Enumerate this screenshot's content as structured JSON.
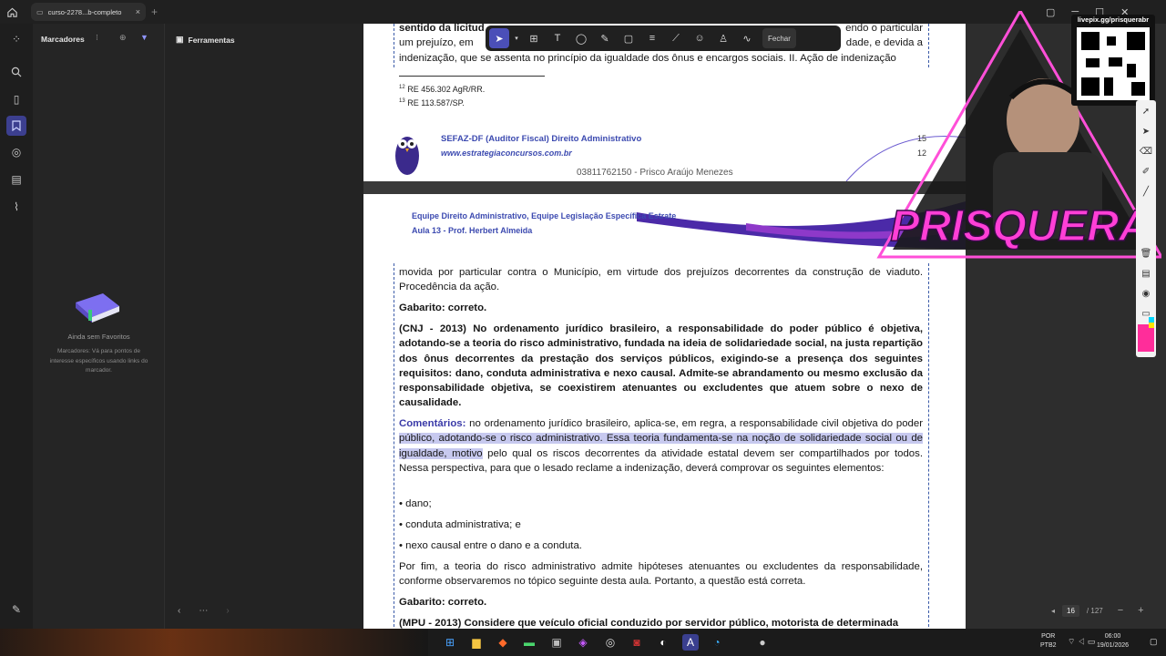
{
  "browser": {
    "tab_title": "curso-2278...b-completo",
    "tab_close": "×",
    "new_tab": "+"
  },
  "sidebar": {
    "header": "Marcadores",
    "empty_title": "Ainda sem Favoritos",
    "empty_desc": "Marcadores: Vá para pontos de interesse específicos usando links do marcador."
  },
  "tools_panel": {
    "header": "Ferramentas"
  },
  "toolbar": {
    "close_label": "Fechar"
  },
  "page1": {
    "line1_bold": "sentido da licitud",
    "line1_rest": "endo o particular",
    "line2_start": "um prejuízo, em",
    "line2_end": "dade, e devida a",
    "line3": "indenização, que se assenta no princípio da igualdade dos ônus e encargos sociais. II. Ação de indenização",
    "fn12_num": "12",
    "fn12": "RE 456.302 AgR/RR.",
    "fn13_num": "13",
    "fn13": "RE 113.587/SP.",
    "org_title": "SEFAZ-DF (Auditor Fiscal) Direito Administrativo",
    "org_url": "www.estrategiaconcursos.com.br",
    "page_id": "03811762150 - Prisco Araújo Menezes",
    "page_num": "15",
    "page_num2": "12"
  },
  "page2": {
    "team_line1": "Equipe Direito Administrativo, Equipe Legislação Específica Estrate",
    "team_line2": "Aula 13 - Prof. Herbert Almeida",
    "p1": "movida por particular contra o Município, em virtude dos prejuízos decorrentes da construção de viaduto. Procedência da ação.",
    "gab1": "Gabarito: correto.",
    "q_cnj": "(CNJ - 2013) No ordenamento jurídico brasileiro, a responsabilidade do poder público é objetiva, adotando-se a teoria do risco administrativo, fundada na ideia de solidariedade social, na justa repartição dos ônus decorrentes da prestação dos serviços públicos, exigindo-se a presença dos seguintes requisitos: dano, conduta administrativa e nexo causal. Admite-se abrandamento ou mesmo exclusão da responsabilidade objetiva, se coexistirem atenuantes ou excludentes que atuem sobre o nexo de causalidade.",
    "com_label": "Comentários:",
    "com_a": " no ordenamento jurídico brasileiro, aplica-se, em regra, a responsabilidade civil objetiva do poder ",
    "com_hl": "público, adotando-se o risco administrativo. Essa teoria fundamenta-se na noção de solidariedade social ou de igualdade, motivo",
    "com_b": " pelo qual os riscos decorrentes da atividade estatal devem ser compartilhados por todos. Nessa perspectiva, para que o lesado reclame a indenização, deverá comprovar os seguintes elementos:",
    "b1": "• dano;",
    "b2": "• conduta administrativa; e",
    "b3": "• nexo causal entre o dano e a conduta.",
    "p_fim": "Por fim, a teoria do risco administrativo admite hipóteses atenuantes ou excludentes da responsabilidade, conforme observaremos no tópico seguinte desta aula. Portanto, a questão está correta.",
    "gab2": "Gabarito: correto.",
    "next_q": "(MPU - 2013) Considere que veículo oficial conduzido por servidor público, motorista de determinada"
  },
  "overlay": {
    "streamer_name": "PRISQUERA",
    "qr_label": "livepix.gg/prisquerabr"
  },
  "pager": {
    "current": "16",
    "total": "/ 127"
  },
  "taskbar": {
    "lang1": "POR",
    "lang2": "PTB2",
    "time": "06:00",
    "date": "19/01/2026"
  }
}
